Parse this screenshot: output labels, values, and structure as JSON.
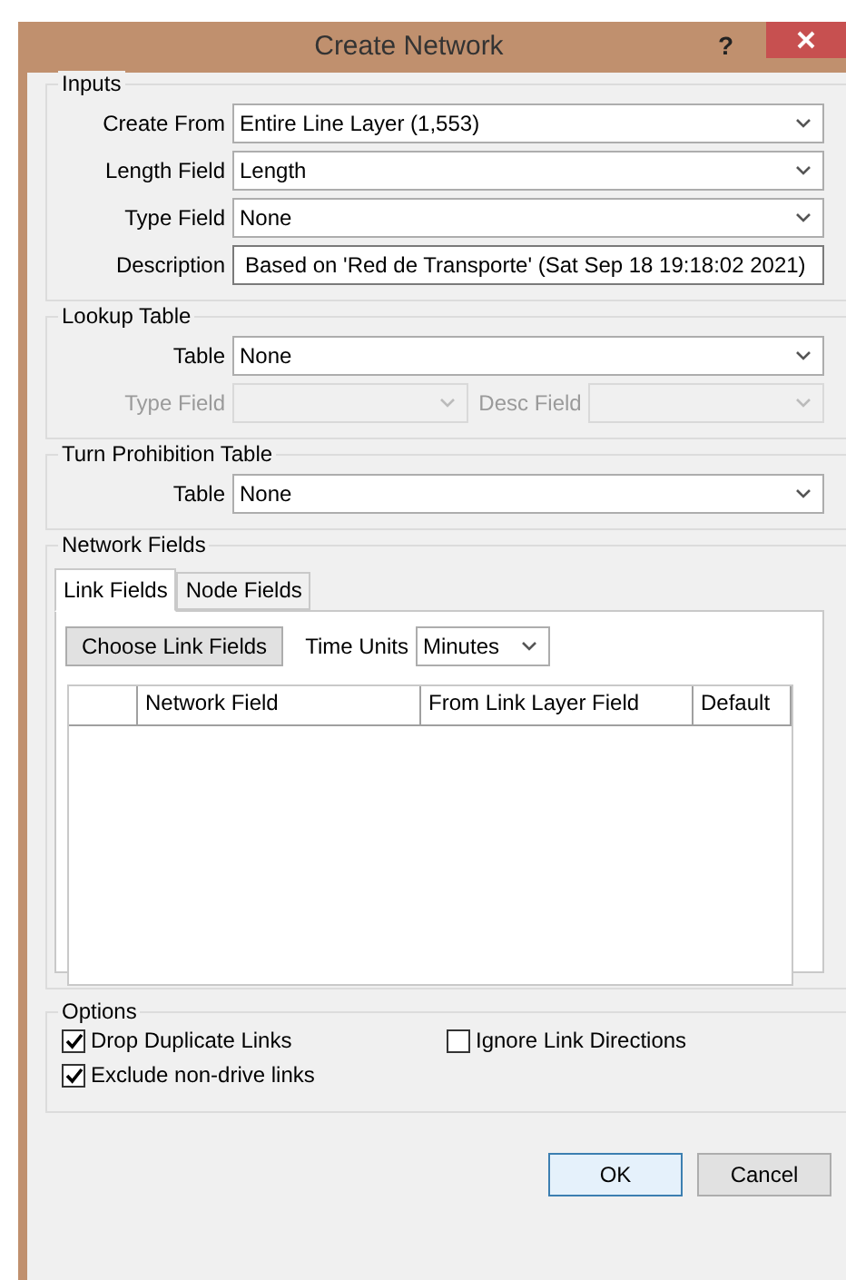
{
  "window": {
    "title": "Create Network",
    "help": "?"
  },
  "inputs": {
    "legend": "Inputs",
    "fields": [
      {
        "label": "Create From",
        "value": "Entire Line Layer (1,553)",
        "kind": "select"
      },
      {
        "label": "Length Field",
        "value": "Length",
        "kind": "select"
      },
      {
        "label": "Type Field",
        "value": "None",
        "kind": "select"
      },
      {
        "label": "Description",
        "value": "Based on 'Red de Transporte' (Sat Sep 18 19:18:02 2021)",
        "kind": "text"
      }
    ]
  },
  "lookup_table": {
    "legend": "Lookup Table",
    "table": {
      "label": "Table",
      "value": "None"
    },
    "pair": [
      {
        "label": "Type Field",
        "disabled": true
      },
      {
        "label": "Desc Field",
        "disabled": true
      }
    ]
  },
  "turn_prohibition_table": {
    "legend": "Turn Prohibition Table",
    "table": {
      "label": "Table",
      "value": "None"
    }
  },
  "network_fields": {
    "legend": "Network Fields",
    "tabs": [
      {
        "label": "Link Fields",
        "selected": true
      },
      {
        "label": "Node Fields",
        "selected": false
      }
    ],
    "choose_button": "Choose Link Fields",
    "time_units": {
      "label": "Time Units",
      "value": "Minutes"
    },
    "columns": [
      "Network Field",
      "From Link Layer Field",
      "Default"
    ]
  },
  "options": {
    "legend": "Options",
    "checkboxes": [
      {
        "label": "Drop Duplicate Links",
        "checked": true
      },
      {
        "label": "Ignore Link Directions",
        "checked": false
      },
      {
        "label": "Exclude non-drive links",
        "checked": true
      }
    ]
  },
  "buttons": [
    {
      "label": "OK",
      "default": true
    },
    {
      "label": "Cancel",
      "default": false
    }
  ]
}
